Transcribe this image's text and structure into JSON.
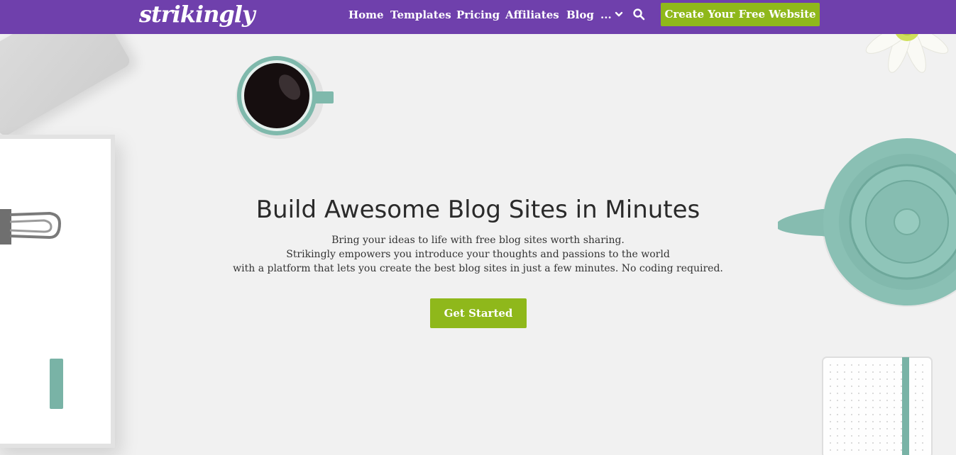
{
  "brand": {
    "logo": "strikingly"
  },
  "nav": {
    "links": [
      {
        "label": "Home"
      },
      {
        "label": "Templates"
      },
      {
        "label": "Pricing"
      },
      {
        "label": "Affiliates"
      },
      {
        "label": "Blog"
      }
    ],
    "more_label": "...",
    "more_icon": "chevron-down-icon",
    "search_icon": "search-icon",
    "cta_label": "Create Your Free Website"
  },
  "hero": {
    "title": "Build Awesome Blog Sites in Minutes",
    "subtitle_lines": [
      "Bring your ideas to life with free blog sites worth sharing.",
      "Strikingly empowers you introduce your thoughts and passions to the world",
      "with a platform that lets you create the best blog sites in just a few minutes. No coding required."
    ],
    "button_label": "Get Started"
  },
  "colors": {
    "nav_bg": "#6f40ac",
    "accent_green": "#8fb81b",
    "page_bg": "#f1f1f1",
    "teal": "#79b3a6"
  }
}
